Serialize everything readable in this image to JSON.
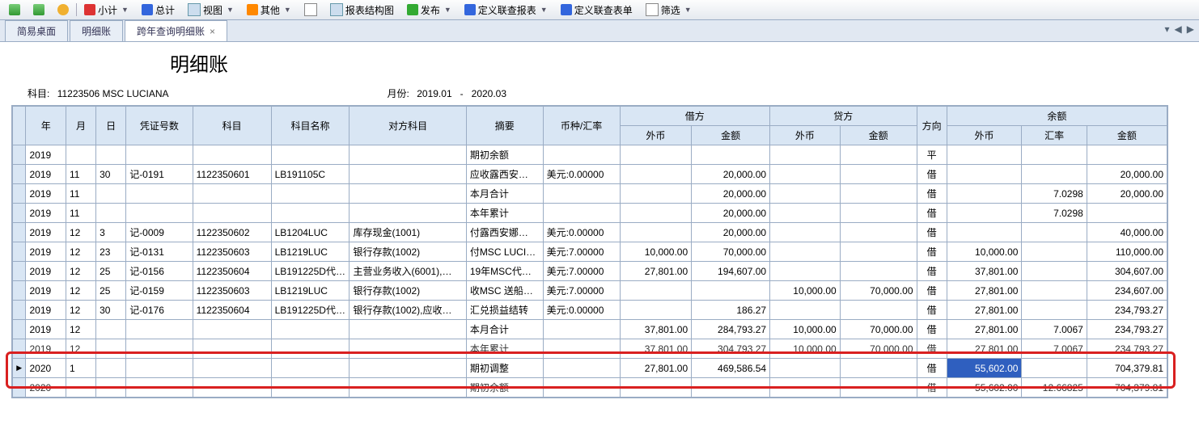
{
  "toolbar": [
    {
      "icon": "ic-back",
      "label": "",
      "drop": false
    },
    {
      "icon": "ic-fwd",
      "label": "",
      "drop": false
    },
    {
      "icon": "ic-ref",
      "label": "",
      "drop": false
    },
    {
      "sep": true
    },
    {
      "icon": "ic-red",
      "label": "小计",
      "drop": true
    },
    {
      "icon": "ic-blue",
      "label": "总计",
      "drop": false
    },
    {
      "icon": "ic-table",
      "label": "视图",
      "drop": true
    },
    {
      "icon": "ic-orange",
      "label": "其他",
      "drop": true
    },
    {
      "icon": "ic-doc",
      "label": "",
      "drop": false
    },
    {
      "icon": "ic-table",
      "label": "报表结构图",
      "drop": false
    },
    {
      "icon": "ic-grn",
      "label": "发布",
      "drop": true
    },
    {
      "icon": "ic-blue",
      "label": "定义联查报表",
      "drop": true
    },
    {
      "icon": "ic-blue",
      "label": "定义联查表单",
      "drop": false
    },
    {
      "icon": "ic-doc",
      "label": "筛选",
      "drop": true
    }
  ],
  "tabs": [
    {
      "label": "简易桌面",
      "active": false,
      "closable": false
    },
    {
      "label": "明细账",
      "active": false,
      "closable": false
    },
    {
      "label": "跨年查询明细账",
      "active": true,
      "closable": true
    }
  ],
  "title": "明细账",
  "meta": {
    "subject_label": "科目:",
    "subject_value": "11223506 MSC LUCIANA",
    "period_label": "月份:",
    "period_from": "2019.01",
    "period_sep": "-",
    "period_to": "2020.03"
  },
  "columns": {
    "row_sel": "",
    "year": "年",
    "month": "月",
    "day": "日",
    "voucher": "凭证号数",
    "subject": "科目",
    "subject_name": "科目名称",
    "opp_subject": "对方科目",
    "summary": "摘要",
    "currency": "币种/汇率",
    "debit": "借方",
    "debit_fc": "外币",
    "debit_amt": "金额",
    "credit": "贷方",
    "credit_fc": "外币",
    "credit_amt": "金额",
    "dir": "方向",
    "balance": "余额",
    "bal_fc": "外币",
    "bal_rate": "汇率",
    "bal_amt": "金额"
  },
  "rows": [
    {
      "y": "2019",
      "m": "",
      "d": "",
      "vno": "",
      "sub": "",
      "sname": "",
      "opp": "",
      "summ": "期初余额",
      "cur": "",
      "dfc": "",
      "damt": "",
      "cfc": "",
      "camt": "",
      "dir": "平",
      "bfc": "",
      "brate": "",
      "bamt": ""
    },
    {
      "y": "2019",
      "m": "11",
      "d": "30",
      "vno": "记-0191",
      "sub": "1122350601",
      "sname": "LB191105C",
      "opp": "",
      "summ": "应收露西安…",
      "cur": "美元:0.00000",
      "dfc": "",
      "damt": "20,000.00",
      "cfc": "",
      "camt": "",
      "dir": "借",
      "bfc": "",
      "brate": "",
      "bamt": "20,000.00"
    },
    {
      "y": "2019",
      "m": "11",
      "d": "",
      "vno": "",
      "sub": "",
      "sname": "",
      "opp": "",
      "summ": "本月合计",
      "cur": "",
      "dfc": "",
      "damt": "20,000.00",
      "cfc": "",
      "camt": "",
      "dir": "借",
      "bfc": "",
      "brate": "7.0298",
      "bamt": "20,000.00"
    },
    {
      "y": "2019",
      "m": "11",
      "d": "",
      "vno": "",
      "sub": "",
      "sname": "",
      "opp": "",
      "summ": "本年累计",
      "cur": "",
      "dfc": "",
      "damt": "20,000.00",
      "cfc": "",
      "camt": "",
      "dir": "借",
      "bfc": "",
      "brate": "7.0298",
      "bamt": ""
    },
    {
      "y": "2019",
      "m": "12",
      "d": "3",
      "vno": "记-0009",
      "sub": "1122350602",
      "sname": "LB1204LUC",
      "opp": "库存现金(1001)",
      "summ": "付露西安娜…",
      "cur": "美元:0.00000",
      "dfc": "",
      "damt": "20,000.00",
      "cfc": "",
      "camt": "",
      "dir": "借",
      "bfc": "",
      "brate": "",
      "bamt": "40,000.00"
    },
    {
      "y": "2019",
      "m": "12",
      "d": "23",
      "vno": "记-0131",
      "sub": "1122350603",
      "sname": "LB1219LUC",
      "opp": "银行存款(1002)",
      "summ": "付MSC LUCIA…",
      "cur": "美元:7.00000",
      "dfc": "10,000.00",
      "damt": "70,000.00",
      "cfc": "",
      "camt": "",
      "dir": "借",
      "bfc": "10,000.00",
      "brate": "",
      "bamt": "110,000.00"
    },
    {
      "y": "2019",
      "m": "12",
      "d": "25",
      "vno": "记-0156",
      "sub": "1122350604",
      "sname": "LB191225D代…",
      "opp": "主营业务收入(6001),…",
      "summ": "19年MSC代理…",
      "cur": "美元:7.00000",
      "dfc": "27,801.00",
      "damt": "194,607.00",
      "cfc": "",
      "camt": "",
      "dir": "借",
      "bfc": "37,801.00",
      "brate": "",
      "bamt": "304,607.00"
    },
    {
      "y": "2019",
      "m": "12",
      "d": "25",
      "vno": "记-0159",
      "sub": "1122350603",
      "sname": "LB1219LUC",
      "opp": "银行存款(1002)",
      "summ": "收MSC 送船…",
      "cur": "美元:7.00000",
      "dfc": "",
      "damt": "",
      "cfc": "10,000.00",
      "camt": "70,000.00",
      "dir": "借",
      "bfc": "27,801.00",
      "brate": "",
      "bamt": "234,607.00"
    },
    {
      "y": "2019",
      "m": "12",
      "d": "30",
      "vno": "记-0176",
      "sub": "1122350604",
      "sname": "LB191225D代…",
      "opp": "银行存款(1002),应收…",
      "summ": "汇兑损益结转",
      "cur": "美元:0.00000",
      "dfc": "",
      "damt": "186.27",
      "cfc": "",
      "camt": "",
      "dir": "借",
      "bfc": "27,801.00",
      "brate": "",
      "bamt": "234,793.27"
    },
    {
      "y": "2019",
      "m": "12",
      "d": "",
      "vno": "",
      "sub": "",
      "sname": "",
      "opp": "",
      "summ": "本月合计",
      "cur": "",
      "dfc": "37,801.00",
      "damt": "284,793.27",
      "cfc": "10,000.00",
      "camt": "70,000.00",
      "dir": "借",
      "bfc": "27,801.00",
      "brate": "7.0067",
      "bamt": "234,793.27"
    },
    {
      "y": "2019",
      "m": "12",
      "d": "",
      "vno": "",
      "sub": "",
      "sname": "",
      "opp": "",
      "summ": "本年累计",
      "cur": "",
      "dfc": "37,801.00",
      "damt": "304,793.27",
      "cfc": "10,000.00",
      "camt": "70,000.00",
      "dir": "借",
      "bfc": "27,801.00",
      "brate": "7.0067",
      "bamt": "234,793.27",
      "cut": true
    },
    {
      "y": "2020",
      "m": "1",
      "d": "",
      "vno": "",
      "sub": "",
      "sname": "",
      "opp": "",
      "summ": "期初调整",
      "cur": "",
      "dfc": "27,801.00",
      "damt": "469,586.54",
      "cfc": "",
      "camt": "",
      "dir": "借",
      "bfc": "55,602.00",
      "brate": "",
      "bamt": "704,379.81",
      "hl": true,
      "ptr": true,
      "selcell": "bfc"
    },
    {
      "y": "2020",
      "m": "",
      "d": "",
      "vno": "",
      "sub": "",
      "sname": "",
      "opp": "",
      "summ": "期初余额",
      "cur": "",
      "dfc": "",
      "damt": "",
      "cfc": "",
      "camt": "",
      "dir": "借",
      "bfc": "55,602.00",
      "brate": "12.66825",
      "bamt": "704,379.81",
      "cut": true
    }
  ],
  "tabctrl": {
    "min": "▾",
    "left": "◀",
    "right": "▶"
  }
}
